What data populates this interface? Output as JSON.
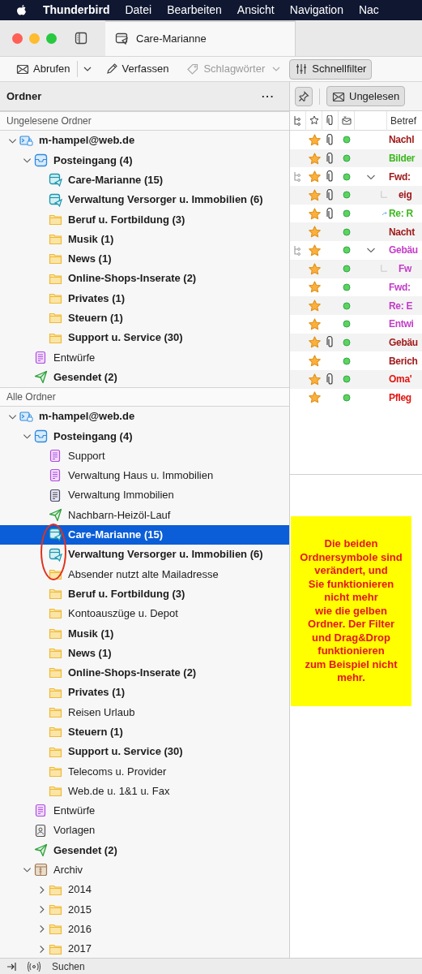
{
  "menu_bar": {
    "app_name": "Thunderbird",
    "items": [
      "Datei",
      "Bearbeiten",
      "Ansicht",
      "Navigation",
      "Nac"
    ]
  },
  "tabs": [
    {
      "label": "Care-Marianne",
      "selected": true
    }
  ],
  "toolbar": [
    {
      "label": "Abrufen",
      "dropdown": true,
      "disabled": false,
      "pressed": false
    },
    {
      "label": "Verfassen",
      "dropdown": false,
      "disabled": false,
      "pressed": false
    },
    {
      "label": "Schlagwörter",
      "disabled": true,
      "dropdown": true,
      "pressed": false
    },
    {
      "label": "Schnellfilter",
      "pressed": true,
      "disabled": false,
      "dropdown": false
    }
  ],
  "folder_pane": {
    "title": "Ordner",
    "menu": "···",
    "sections": [
      {
        "title": "Ungelesene Ordner",
        "folders": [
          {
            "name": "m-hampel@web.de",
            "kind": "account",
            "unread": true,
            "selected": false,
            "expanded": true,
            "children": [
              {
                "name": "Posteingang (4)",
                "kind": "inbox",
                "unread": true,
                "selected": false,
                "expanded": true,
                "children": [
                  {
                    "name": "Care-Marianne (15)",
                    "kind": "smart",
                    "unread": true,
                    "selected": false
                  },
                  {
                    "name": "Verwaltung Versorger u. Immobilien (6)",
                    "kind": "smart",
                    "unread": true,
                    "selected": false
                  },
                  {
                    "name": "Beruf u. Fortbildung (3)",
                    "kind": "folder",
                    "unread": true,
                    "selected": false
                  },
                  {
                    "name": "Musik (1)",
                    "kind": "folder",
                    "unread": true,
                    "selected": false
                  },
                  {
                    "name": "News (1)",
                    "kind": "folder",
                    "unread": true,
                    "selected": false
                  },
                  {
                    "name": "Online-Shops-Inserate (2)",
                    "kind": "folder",
                    "unread": true,
                    "selected": false
                  },
                  {
                    "name": "Privates (1)",
                    "kind": "folder",
                    "unread": true,
                    "selected": false
                  },
                  {
                    "name": "Steuern (1)",
                    "kind": "folder",
                    "unread": true,
                    "selected": false
                  },
                  {
                    "name": "Support u. Service (30)",
                    "kind": "folder",
                    "unread": true,
                    "selected": false
                  }
                ]
              },
              {
                "name": "Entwürfe",
                "kind": "drafts",
                "unread": false,
                "selected": false
              },
              {
                "name": "Gesendet (2)",
                "kind": "sent",
                "unread": true,
                "selected": false
              }
            ]
          }
        ]
      },
      {
        "title": "Alle Ordner",
        "folders": [
          {
            "name": "m-hampel@web.de",
            "kind": "account",
            "unread": true,
            "selected": false,
            "expanded": true,
            "children": [
              {
                "name": "Posteingang (4)",
                "kind": "inbox",
                "unread": true,
                "selected": false,
                "expanded": true,
                "children": [
                  {
                    "name": "Support",
                    "kind": "drafts",
                    "unread": false,
                    "selected": false
                  },
                  {
                    "name": "Verwaltung Haus u. Immobilien",
                    "kind": "drafts",
                    "unread": false,
                    "selected": false
                  },
                  {
                    "name": "Verwaltung Immobilien",
                    "kind": "document",
                    "unread": false,
                    "selected": false
                  },
                  {
                    "name": "Nachbarn-Heizöl-Lauf",
                    "kind": "sent",
                    "unread": false,
                    "selected": false
                  },
                  {
                    "name": "Care-Marianne (15)",
                    "kind": "smart",
                    "unread": true,
                    "selected": true
                  },
                  {
                    "name": "Verwaltung Versorger u. Immobilien (6)",
                    "kind": "smart",
                    "unread": true,
                    "selected": false
                  },
                  {
                    "name": "Absender nutzt alte Mailadresse",
                    "kind": "folder",
                    "unread": false,
                    "selected": false
                  },
                  {
                    "name": "Beruf u. Fortbildung (3)",
                    "kind": "folder",
                    "unread": true,
                    "selected": false
                  },
                  {
                    "name": "Kontoauszüge u. Depot",
                    "kind": "folder",
                    "unread": false,
                    "selected": false
                  },
                  {
                    "name": "Musik (1)",
                    "kind": "folder",
                    "unread": true,
                    "selected": false
                  },
                  {
                    "name": "News (1)",
                    "kind": "folder",
                    "unread": true,
                    "selected": false
                  },
                  {
                    "name": "Online-Shops-Inserate (2)",
                    "kind": "folder",
                    "unread": true,
                    "selected": false
                  },
                  {
                    "name": "Privates (1)",
                    "kind": "folder",
                    "unread": true,
                    "selected": false
                  },
                  {
                    "name": "Reisen Urlaub",
                    "kind": "folder",
                    "unread": false,
                    "selected": false
                  },
                  {
                    "name": "Steuern (1)",
                    "kind": "folder",
                    "unread": true,
                    "selected": false
                  },
                  {
                    "name": "Support u. Service (30)",
                    "kind": "folder",
                    "unread": true,
                    "selected": false
                  },
                  {
                    "name": "Telecoms u. Provider",
                    "kind": "folder",
                    "unread": false,
                    "selected": false
                  },
                  {
                    "name": "Web.de u. 1&1 u. Fax",
                    "kind": "folder",
                    "unread": false,
                    "selected": false
                  }
                ]
              },
              {
                "name": "Entwürfe",
                "kind": "drafts",
                "unread": false,
                "selected": false
              },
              {
                "name": "Vorlagen",
                "kind": "templates",
                "unread": false,
                "selected": false
              },
              {
                "name": "Gesendet (2)",
                "kind": "sent",
                "unread": true,
                "selected": false
              },
              {
                "name": "Archiv",
                "kind": "archive",
                "unread": false,
                "selected": false,
                "expanded": true,
                "children": [
                  {
                    "name": "2014",
                    "kind": "folder",
                    "unread": false,
                    "selected": false,
                    "expanded": false
                  },
                  {
                    "name": "2015",
                    "kind": "folder",
                    "unread": false,
                    "selected": false,
                    "expanded": false
                  },
                  {
                    "name": "2016",
                    "kind": "folder",
                    "unread": false,
                    "selected": false,
                    "expanded": false
                  },
                  {
                    "name": "2017",
                    "kind": "folder",
                    "unread": false,
                    "selected": false,
                    "expanded": false
                  }
                ]
              }
            ]
          }
        ]
      }
    ]
  },
  "quick_filter": {
    "unread_label": "Ungelesen",
    "unread_pressed": true
  },
  "message_list": {
    "subject_header": "Betref",
    "messages": [
      {
        "subject": "Nachl",
        "color": "#a01a1a",
        "kind": "single",
        "starred": true,
        "attachment": true,
        "forwarded": false
      },
      {
        "subject": "Bilder",
        "color": "#3cb81c",
        "kind": "single",
        "starred": true,
        "attachment": true,
        "forwarded": false
      },
      {
        "subject": "Fwd:",
        "color": "#a01a1a",
        "kind": "parent",
        "starred": true,
        "attachment": true,
        "forwarded": false
      },
      {
        "subject": "eig",
        "color": "#a01a1a",
        "kind": "child",
        "starred": true,
        "attachment": true,
        "forwarded": false
      },
      {
        "subject": "Re: R",
        "color": "#3cb81c",
        "kind": "single",
        "starred": true,
        "attachment": true,
        "forwarded": true
      },
      {
        "subject": "Nacht",
        "color": "#a01a1a",
        "kind": "single",
        "starred": true,
        "attachment": false,
        "forwarded": false
      },
      {
        "subject": "Gebäu",
        "color": "#c23cc8",
        "kind": "parent",
        "starred": true,
        "attachment": false,
        "forwarded": false
      },
      {
        "subject": "Fw",
        "color": "#c23cc8",
        "kind": "child",
        "starred": true,
        "attachment": false,
        "forwarded": false
      },
      {
        "subject": "Fwd:",
        "color": "#c23cc8",
        "kind": "single",
        "starred": true,
        "attachment": false,
        "forwarded": false
      },
      {
        "subject": "Re: E",
        "color": "#c23cc8",
        "kind": "single",
        "starred": true,
        "attachment": false,
        "forwarded": false
      },
      {
        "subject": "Entwi",
        "color": "#c23cc8",
        "kind": "single",
        "starred": true,
        "attachment": false,
        "forwarded": false
      },
      {
        "subject": "Gebäu",
        "color": "#a01a1a",
        "kind": "single",
        "starred": true,
        "attachment": true,
        "forwarded": false
      },
      {
        "subject": "Berich",
        "color": "#a01a1a",
        "kind": "single",
        "starred": true,
        "attachment": false,
        "forwarded": false
      },
      {
        "subject": "Oma'",
        "color": "#e3140f",
        "kind": "single",
        "starred": true,
        "attachment": true,
        "forwarded": false
      },
      {
        "subject": "Pfleg",
        "color": "#e3140f",
        "kind": "single",
        "starred": true,
        "attachment": false,
        "forwarded": false
      }
    ]
  },
  "annotation": {
    "lines": [
      "Die beiden",
      "Ordnersymbole sind",
      "verändert, und",
      "Sie funktionieren",
      "nicht mehr",
      "wie die gelben",
      "Ordner. Der Filter",
      "und Drag&Drop",
      "funktionieren",
      "zum Beispiel nicht",
      "mehr."
    ]
  },
  "status_bar": {
    "search_label": "Suchen"
  }
}
